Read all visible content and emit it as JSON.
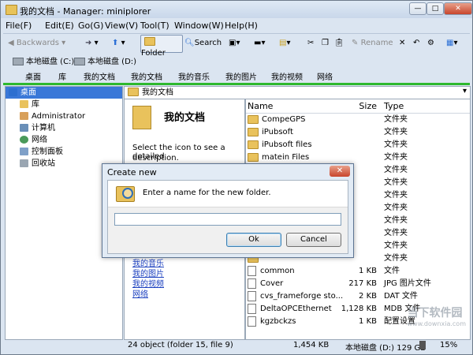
{
  "window": {
    "title": "我的文档 - Manager: miniplorer"
  },
  "titlebar_buttons": {
    "minimize": "—",
    "maximize": "□",
    "close": "✕"
  },
  "menu": [
    "File(F)",
    "Edit(E)",
    "Go(G)",
    "View(V)",
    "Tool(T)",
    "Window(W)",
    "Help(H)"
  ],
  "toolbar": {
    "back": "Backwards",
    "folder": "Folder",
    "search": "Search",
    "rename": "Rename"
  },
  "drives": [
    "本地磁盘 (C:)",
    "本地磁盘 (D:)"
  ],
  "bookmarks": [
    "桌面",
    "库",
    "我的文档",
    "我的文档",
    "我的音乐",
    "我的图片",
    "我的视频",
    "网络"
  ],
  "address": "我的文档",
  "tree": [
    {
      "label": "桌面",
      "selected": true
    },
    {
      "label": "库"
    },
    {
      "label": "Administrator"
    },
    {
      "label": "计算机"
    },
    {
      "label": "网络"
    },
    {
      "label": "控制面板"
    },
    {
      "label": "回收站"
    }
  ],
  "info_panel": {
    "title": "我的文档",
    "desc_line1": "Select the icon to see a detailed",
    "desc_line2": "description.",
    "links": [
      "我的音乐",
      "我的图片",
      "我的视频",
      "网络"
    ]
  },
  "file_list": {
    "headers": {
      "name": "Name",
      "size": "Size",
      "type": "Type"
    },
    "rows": [
      {
        "name": "CompeGPS",
        "size": "",
        "type": "文件夹",
        "kind": "folder"
      },
      {
        "name": "iPubsoft",
        "size": "",
        "type": "文件夹",
        "kind": "folder"
      },
      {
        "name": "iPubsoft files",
        "size": "",
        "type": "文件夹",
        "kind": "folder"
      },
      {
        "name": "matein Files",
        "size": "",
        "type": "文件夹",
        "kind": "folder"
      },
      {
        "name": "",
        "size": "",
        "type": "文件夹",
        "kind": "folder"
      },
      {
        "name": "",
        "size": "",
        "type": "文件夹",
        "kind": "folder"
      },
      {
        "name": "",
        "size": "",
        "type": "文件夹",
        "kind": "folder"
      },
      {
        "name": "",
        "size": "",
        "type": "文件夹",
        "kind": "folder"
      },
      {
        "name": "",
        "size": "",
        "type": "文件夹",
        "kind": "folder"
      },
      {
        "name": "",
        "size": "",
        "type": "文件夹",
        "kind": "folder"
      },
      {
        "name": "",
        "size": "",
        "type": "文件夹",
        "kind": "folder"
      },
      {
        "name": "",
        "size": "",
        "type": "文件夹",
        "kind": "folder"
      },
      {
        "name": "common",
        "size": "1 KB",
        "type": "文件",
        "kind": "file"
      },
      {
        "name": "Cover",
        "size": "217 KB",
        "type": "JPG 图片文件",
        "kind": "file"
      },
      {
        "name": "cvs_frameforge sto...",
        "size": "2 KB",
        "type": "DAT 文件",
        "kind": "file"
      },
      {
        "name": "DeltaOPCEthernet",
        "size": "1,128 KB",
        "type": "MDB 文件",
        "kind": "file"
      },
      {
        "name": "kgzbckzs",
        "size": "1 KB",
        "type": "配置设置",
        "kind": "file"
      }
    ]
  },
  "status": {
    "objects": "24 object (folder 15, file 9)",
    "size": "1,454 KB",
    "free": "本地磁盘 (D:) 129 GB",
    "percent": "15%"
  },
  "dialog": {
    "title": "Create new",
    "message": "Enter a name for the new folder.",
    "input_value": "",
    "ok": "Ok",
    "cancel": "Cancel"
  },
  "watermark": {
    "text": "当下软件园",
    "sub": "www.downxia.com"
  }
}
